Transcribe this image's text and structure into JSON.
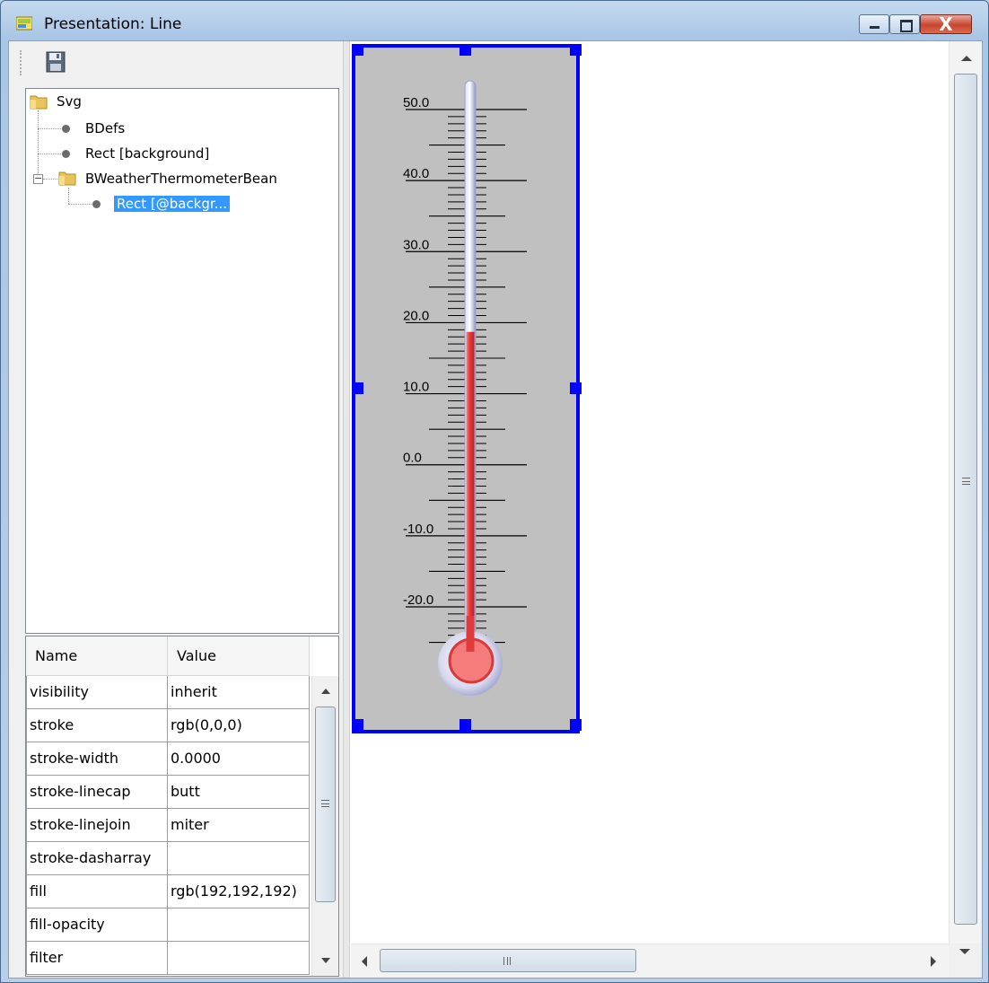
{
  "window": {
    "title": "Presentation: Line",
    "close_symbol": "X"
  },
  "toolbar": {
    "save_icon": "floppy-disk-icon"
  },
  "tree": {
    "root": "Svg",
    "items": [
      {
        "label": "BDefs",
        "icon": "bullet-icon"
      },
      {
        "label": "Rect [background]",
        "icon": "bullet-icon"
      },
      {
        "label": "BWeatherThermometerBean",
        "icon": "folder-icon",
        "expanded": true
      },
      {
        "label": "Rect [@backgr...",
        "icon": "bullet-icon",
        "selected": true
      }
    ]
  },
  "properties": {
    "headers": {
      "name": "Name",
      "value": "Value"
    },
    "rows": [
      {
        "name": "visibility",
        "value": "inherit"
      },
      {
        "name": "stroke",
        "value": "rgb(0,0,0)"
      },
      {
        "name": "stroke-width",
        "value": "0.0000"
      },
      {
        "name": "stroke-linecap",
        "value": "butt"
      },
      {
        "name": "stroke-linejoin",
        "value": "miter"
      },
      {
        "name": "stroke-dasharray",
        "value": ""
      },
      {
        "name": "fill",
        "value": "rgb(192,192,192)"
      },
      {
        "name": "fill-opacity",
        "value": ""
      },
      {
        "name": "filter",
        "value": ""
      }
    ]
  },
  "thermometer": {
    "scale_labels": [
      "50.0",
      "40.0",
      "30.0",
      "20.0",
      "10.0",
      "0.0",
      "-10.0",
      "-20.0"
    ],
    "min": -25,
    "max": 50,
    "current_value": 18.7,
    "background_color": "#c0c0c0",
    "selection_color": "#0000ff",
    "mercury_color": "#e03a3a"
  },
  "colors": {
    "selection": "#3399ff",
    "title_bar": "#c5daf0"
  }
}
